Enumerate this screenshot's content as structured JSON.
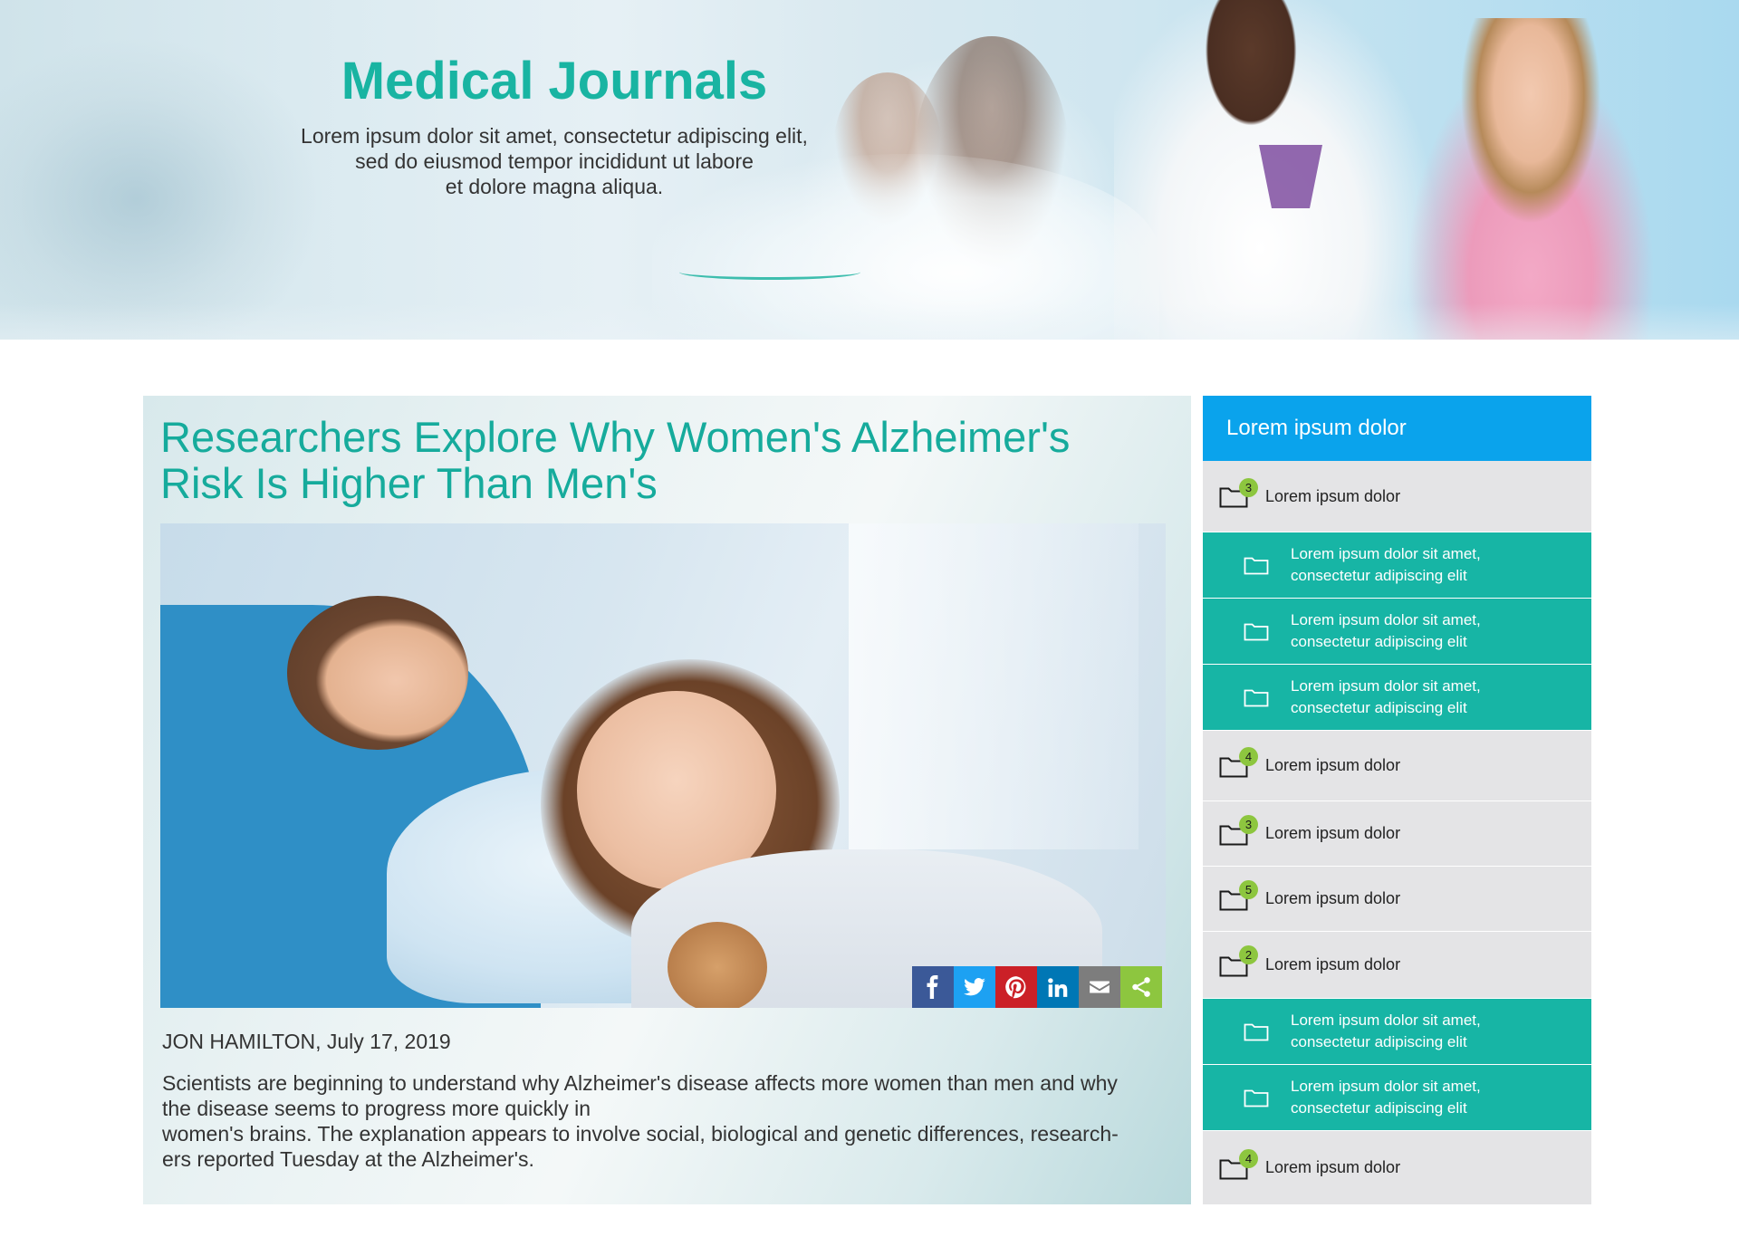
{
  "hero": {
    "title": "Medical Journals",
    "subtitle_lines": [
      "Lorem ipsum dolor sit amet, consectetur adipiscing elit,",
      "sed do eiusmod tempor incididunt ut labore",
      "et dolore magna aliqua."
    ]
  },
  "article": {
    "title_lines": [
      "Researchers Explore Why Women's Alzheimer's",
      "Risk Is Higher Than Men's"
    ],
    "byline": "JON HAMILTON, July 17, 2019",
    "body_lines": [
      "Scientists are beginning to understand why Alzheimer's disease affects more women than men and why",
      "the disease seems to progress more quickly in",
      "women's brains. The explanation appears to involve social, biological and genetic differences, research-",
      "ers reported Tuesday at the Alzheimer's."
    ],
    "share_buttons": [
      {
        "name": "facebook",
        "icon": "facebook-icon",
        "color": "#3b5998"
      },
      {
        "name": "twitter",
        "icon": "twitter-icon",
        "color": "#1da1f2"
      },
      {
        "name": "pinterest",
        "icon": "pinterest-icon",
        "color": "#cb2027"
      },
      {
        "name": "linkedin",
        "icon": "linkedin-icon",
        "color": "#0077b5"
      },
      {
        "name": "email",
        "icon": "envelope-icon",
        "color": "#7d7d7d"
      },
      {
        "name": "share",
        "icon": "share-icon",
        "color": "#8dc63f"
      }
    ]
  },
  "sidebar": {
    "header": "Lorem ipsum dolor",
    "items": [
      {
        "type": "category",
        "label": "Lorem ipsum dolor",
        "badge": "3"
      },
      {
        "type": "sub",
        "lines": [
          "Lorem ipsum dolor sit amet,",
          "consectetur adipiscing elit"
        ]
      },
      {
        "type": "sub",
        "lines": [
          "Lorem ipsum dolor sit amet,",
          "consectetur adipiscing elit"
        ]
      },
      {
        "type": "sub",
        "lines": [
          "Lorem ipsum dolor sit amet,",
          "consectetur adipiscing elit"
        ]
      },
      {
        "type": "category",
        "label": "Lorem ipsum dolor",
        "badge": "4"
      },
      {
        "type": "category",
        "label": "Lorem ipsum dolor",
        "badge": "3"
      },
      {
        "type": "category",
        "label": "Lorem ipsum dolor",
        "badge": "5"
      },
      {
        "type": "category",
        "label": "Lorem ipsum dolor",
        "badge": "2"
      },
      {
        "type": "sub",
        "lines": [
          "Lorem ipsum dolor sit amet,",
          "consectetur adipiscing elit"
        ]
      },
      {
        "type": "sub",
        "lines": [
          "Lorem ipsum dolor sit amet,",
          "consectetur adipiscing elit"
        ]
      },
      {
        "type": "category",
        "label": "Lorem ipsum dolor",
        "badge": "4"
      }
    ]
  },
  "colors": {
    "accent_teal": "#17b5a5",
    "header_blue": "#0aa3ec",
    "badge_green": "#8dc63f",
    "sidebar_gray": "#e4e4e6"
  }
}
